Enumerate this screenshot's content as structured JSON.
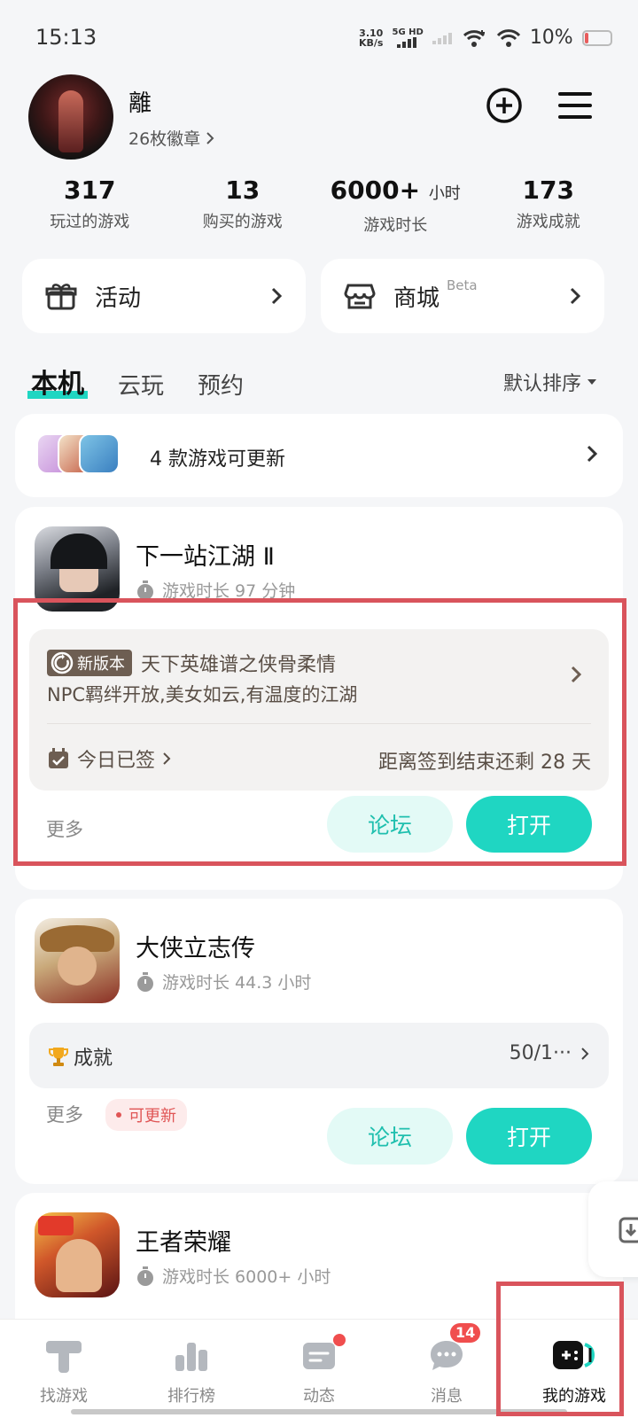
{
  "status_bar": {
    "time": "15:13",
    "net_speed_value": "3.10",
    "net_speed_unit": "KB/s",
    "signal_label": "5G HD",
    "battery_pct": "10%",
    "battery_level": 0.1
  },
  "profile": {
    "username": "離",
    "badges": "26枚徽章"
  },
  "stats": [
    {
      "num": "317",
      "unit": "",
      "label": "玩过的游戏"
    },
    {
      "num": "13",
      "unit": "",
      "label": "购买的游戏"
    },
    {
      "num": "6000+",
      "unit": "小时",
      "label": "游戏时长"
    },
    {
      "num": "173",
      "unit": "",
      "label": "游戏成就"
    }
  ],
  "quick_cards": {
    "activity": "活动",
    "mall": "商城",
    "mall_tag": "Beta"
  },
  "tabs": [
    "本机",
    "云玩",
    "预约"
  ],
  "sort_label": "默认排序",
  "update_bar": {
    "text": "4 款游戏可更新"
  },
  "games": [
    {
      "name": "下一站江湖 Ⅱ",
      "playtime": "游戏时长 97 分钟",
      "new_version_badge": "新版本",
      "event_title": "天下英雄谱之侠骨柔情",
      "event_desc": "NPC羁绊开放,美女如云,有温度的江湖",
      "checkin": "今日已签",
      "checkin_remaining": "距离签到结束还剩 28 天",
      "more": "更多",
      "forum": "论坛",
      "open": "打开"
    },
    {
      "name": "大侠立志传",
      "playtime": "游戏时长 44.3 小时",
      "achievement_label": "成就",
      "achievement_value": "50/1···",
      "more": "更多",
      "update_tag": "可更新",
      "forum": "论坛",
      "open": "打开"
    },
    {
      "name": "王者荣耀",
      "playtime": "游戏时长 6000+ 小时"
    }
  ],
  "nav": [
    {
      "label": "找游戏",
      "icon": "find-game-icon"
    },
    {
      "label": "排行榜",
      "icon": "ranking-icon"
    },
    {
      "label": "动态",
      "icon": "feed-icon"
    },
    {
      "label": "消息",
      "icon": "message-icon",
      "badge": "14"
    },
    {
      "label": "我的游戏",
      "icon": "my-games-icon"
    }
  ],
  "colors": {
    "accent": "#1fd6c2",
    "highlight_box": "#d9545c",
    "badge_red": "#f04e4e"
  }
}
